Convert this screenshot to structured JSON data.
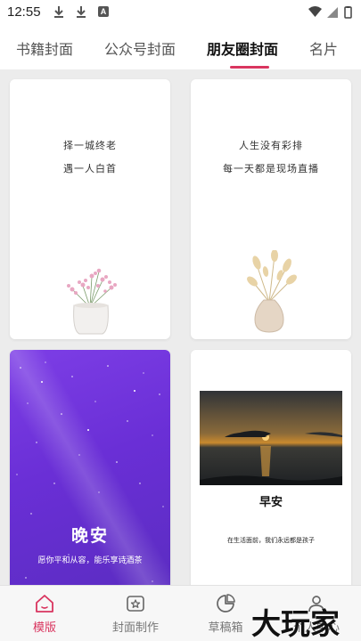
{
  "status_bar": {
    "time": "12:55"
  },
  "tabs": [
    {
      "label": "书籍封面"
    },
    {
      "label": "公众号封面"
    },
    {
      "label": "朋友圈封面"
    },
    {
      "label": "名片"
    }
  ],
  "active_tab": "朋友圈封面",
  "cards": [
    {
      "line1": "择一城终老",
      "line2": "遇一人白首"
    },
    {
      "line1": "人生没有彩排",
      "line2": "每一天都是现场直播"
    },
    {
      "title": "晚安",
      "subtitle": "愿你平和从容，能乐享诗酒茶"
    },
    {
      "title": "早安",
      "subtitle": "在生活面前，我们永远都是孩子"
    }
  ],
  "bottom_nav": [
    {
      "label": "模版",
      "icon": "home-icon"
    },
    {
      "label": "封面制作",
      "icon": "cover-make-icon"
    },
    {
      "label": "草稿箱",
      "icon": "draft-icon"
    },
    {
      "label": "个人中心",
      "icon": "person-icon"
    }
  ],
  "watermark": {
    "text": "大玩家"
  },
  "colors": {
    "accent": "#d9355f",
    "night_card": "#6a2fd6"
  }
}
